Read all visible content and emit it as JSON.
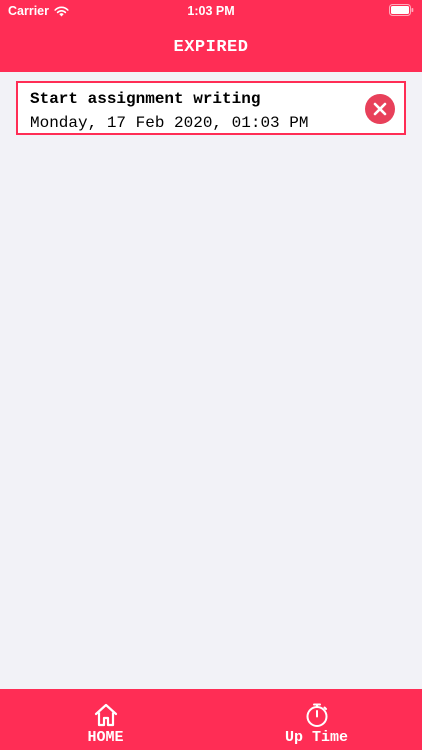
{
  "status_bar": {
    "carrier": "Carrier",
    "time": "1:03 PM",
    "wifi_icon": "wifi-icon",
    "battery_icon": "battery-icon"
  },
  "header": {
    "title": "EXPIRED"
  },
  "items": [
    {
      "title": "Start assignment writing",
      "date": "Monday, 17 Feb 2020, 01:03 PM",
      "delete_icon": "close-circle-icon"
    }
  ],
  "tabs": [
    {
      "label": "HOME",
      "icon": "home-icon"
    },
    {
      "label": "Up Time",
      "icon": "stopwatch-icon"
    }
  ],
  "colors": {
    "accent": "#FF2D55",
    "background": "#F2F2F7",
    "delete": "#E8405A",
    "text": "#000000",
    "on_accent": "#FFFFFF"
  }
}
